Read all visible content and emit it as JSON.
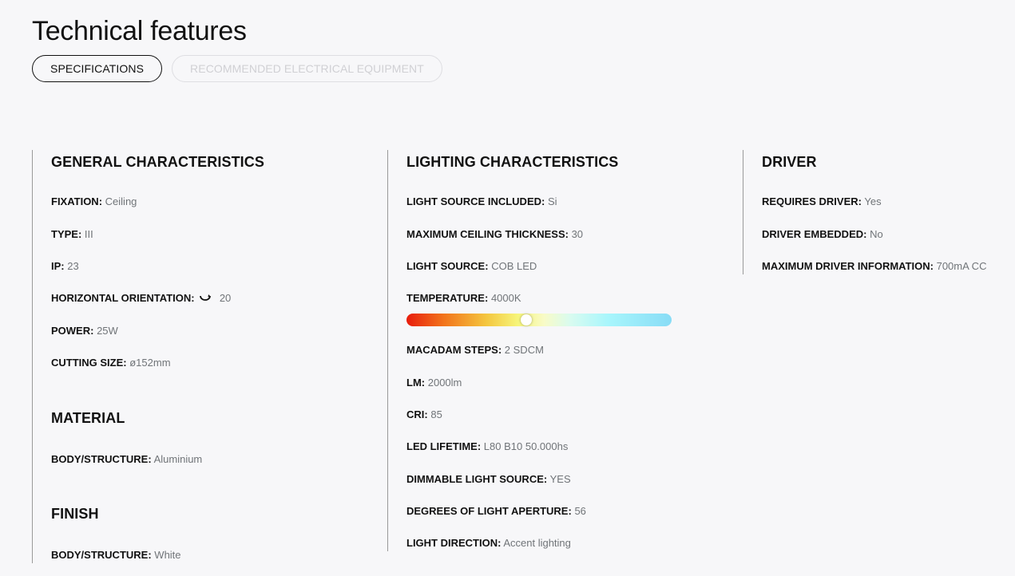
{
  "title": "Technical features",
  "tabs": [
    {
      "label": "SPECIFICATIONS",
      "active": true
    },
    {
      "label": "RECOMMENDED ELECTRICAL EQUIPMENT",
      "active": false
    }
  ],
  "general": {
    "title": "GENERAL CHARACTERISTICS",
    "rows": [
      {
        "key": "FIXATION:",
        "value": "Ceiling"
      },
      {
        "key": "TYPE:",
        "value": "III"
      },
      {
        "key": "IP:",
        "value": "23"
      },
      {
        "key": "HORIZONTAL ORIENTATION:",
        "value": "20",
        "icon": "rotate-icon"
      },
      {
        "key": "POWER:",
        "value": "25W"
      },
      {
        "key": "CUTTING SIZE:",
        "value": "ø152mm"
      }
    ]
  },
  "material": {
    "title": "MATERIAL",
    "rows": [
      {
        "key": "BODY/STRUCTURE:",
        "value": "Aluminium"
      }
    ]
  },
  "finish": {
    "title": "FINISH",
    "rows": [
      {
        "key": "BODY/STRUCTURE:",
        "value": "White"
      }
    ]
  },
  "lighting": {
    "title": "LIGHTING CHARACTERISTICS",
    "rows": [
      {
        "key": "LIGHT SOURCE INCLUDED:",
        "value": "Si"
      },
      {
        "key": "MAXIMUM CEILING THICKNESS:",
        "value": "30"
      },
      {
        "key": "LIGHT SOURCE:",
        "value": "COB LED"
      },
      {
        "key": "TEMPERATURE:",
        "value": "4000K"
      },
      {
        "key": "MACADAM STEPS:",
        "value": "2 SDCM"
      },
      {
        "key": "LM:",
        "value": "2000lm"
      },
      {
        "key": "CRI:",
        "value": "85"
      },
      {
        "key": "LED LIFETIME:",
        "value": "L80 B10 50.000hs"
      },
      {
        "key": "DIMMABLE LIGHT SOURCE:",
        "value": "YES"
      },
      {
        "key": "DEGREES OF LIGHT APERTURE:",
        "value": "56"
      },
      {
        "key": "LIGHT DIRECTION:",
        "value": "Accent lighting"
      }
    ],
    "temperature_scale": {
      "position_fraction": 0.45
    }
  },
  "driver": {
    "title": "DRIVER",
    "rows": [
      {
        "key": "REQUIRES DRIVER:",
        "value": "Yes"
      },
      {
        "key": "DRIVER EMBEDDED:",
        "value": "No"
      },
      {
        "key": "MAXIMUM DRIVER INFORMATION:",
        "value": "700mA CC"
      }
    ]
  },
  "colors": {
    "background": "#f7f7f9",
    "label": "#111111",
    "value": "#707478",
    "tab_inactive": "#d0d0d4"
  }
}
